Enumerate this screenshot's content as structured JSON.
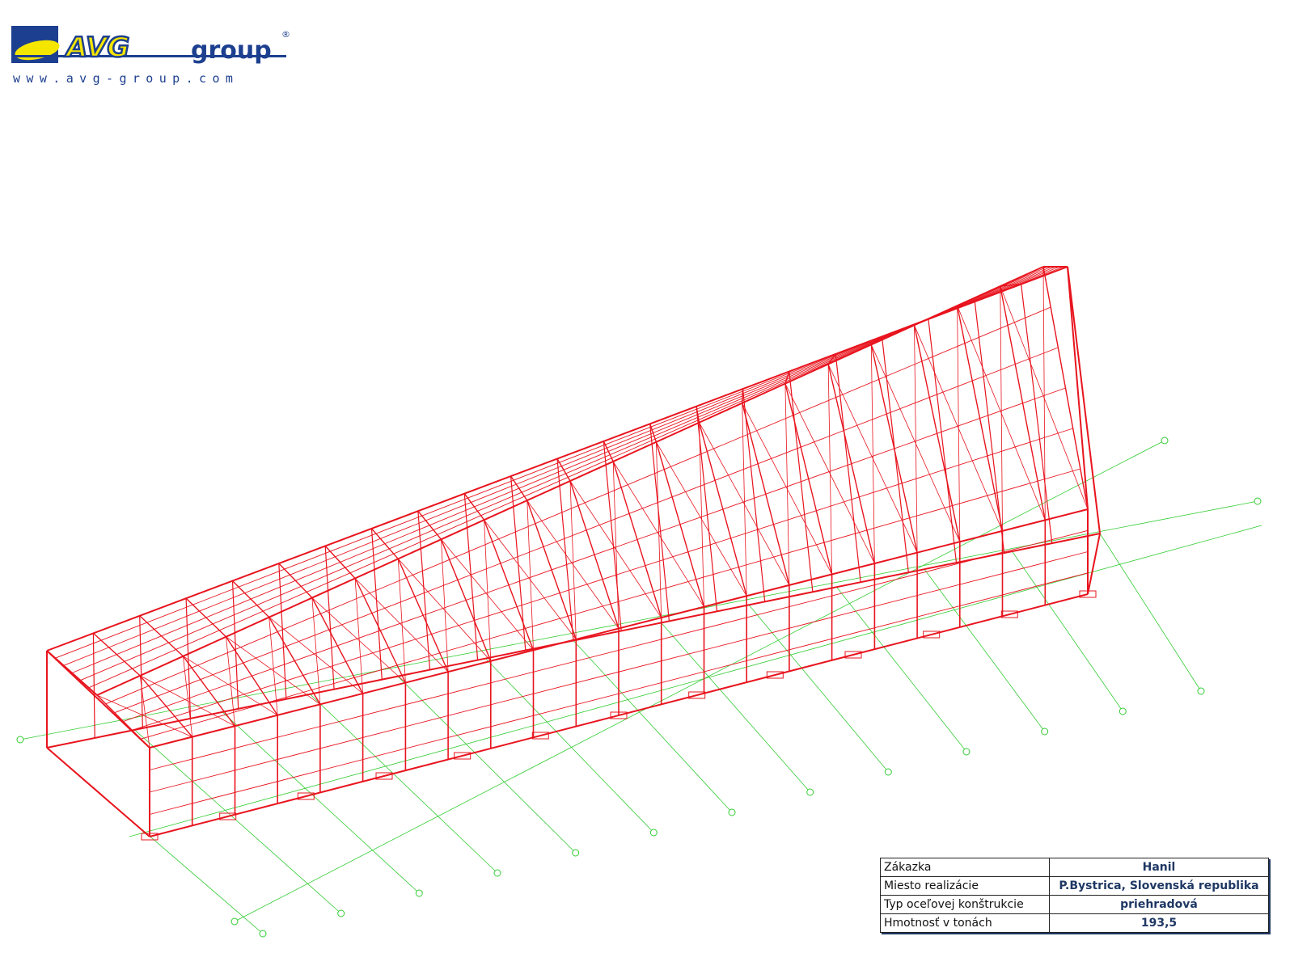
{
  "header": {
    "brand_mark": "AVG",
    "brand_word": "group",
    "registered": "®",
    "website": "www.avg-group.com"
  },
  "colors": {
    "steel": "#e8141e",
    "grid": "#33cc33",
    "logo_blue": "#1d3f8f",
    "logo_yellow": "#f5e600",
    "table_text": "#1f3864"
  },
  "project_info": {
    "rows": [
      {
        "label": "Zákazka",
        "value": "Hanil"
      },
      {
        "label": "Miesto realizácie",
        "value": "P.Bystrica, Slovenská republika"
      },
      {
        "label": "Typ oceľovej konštrukcie",
        "value": "priehradová"
      },
      {
        "label": "Hmotnosť v tonách",
        "value": "193,5"
      }
    ]
  }
}
